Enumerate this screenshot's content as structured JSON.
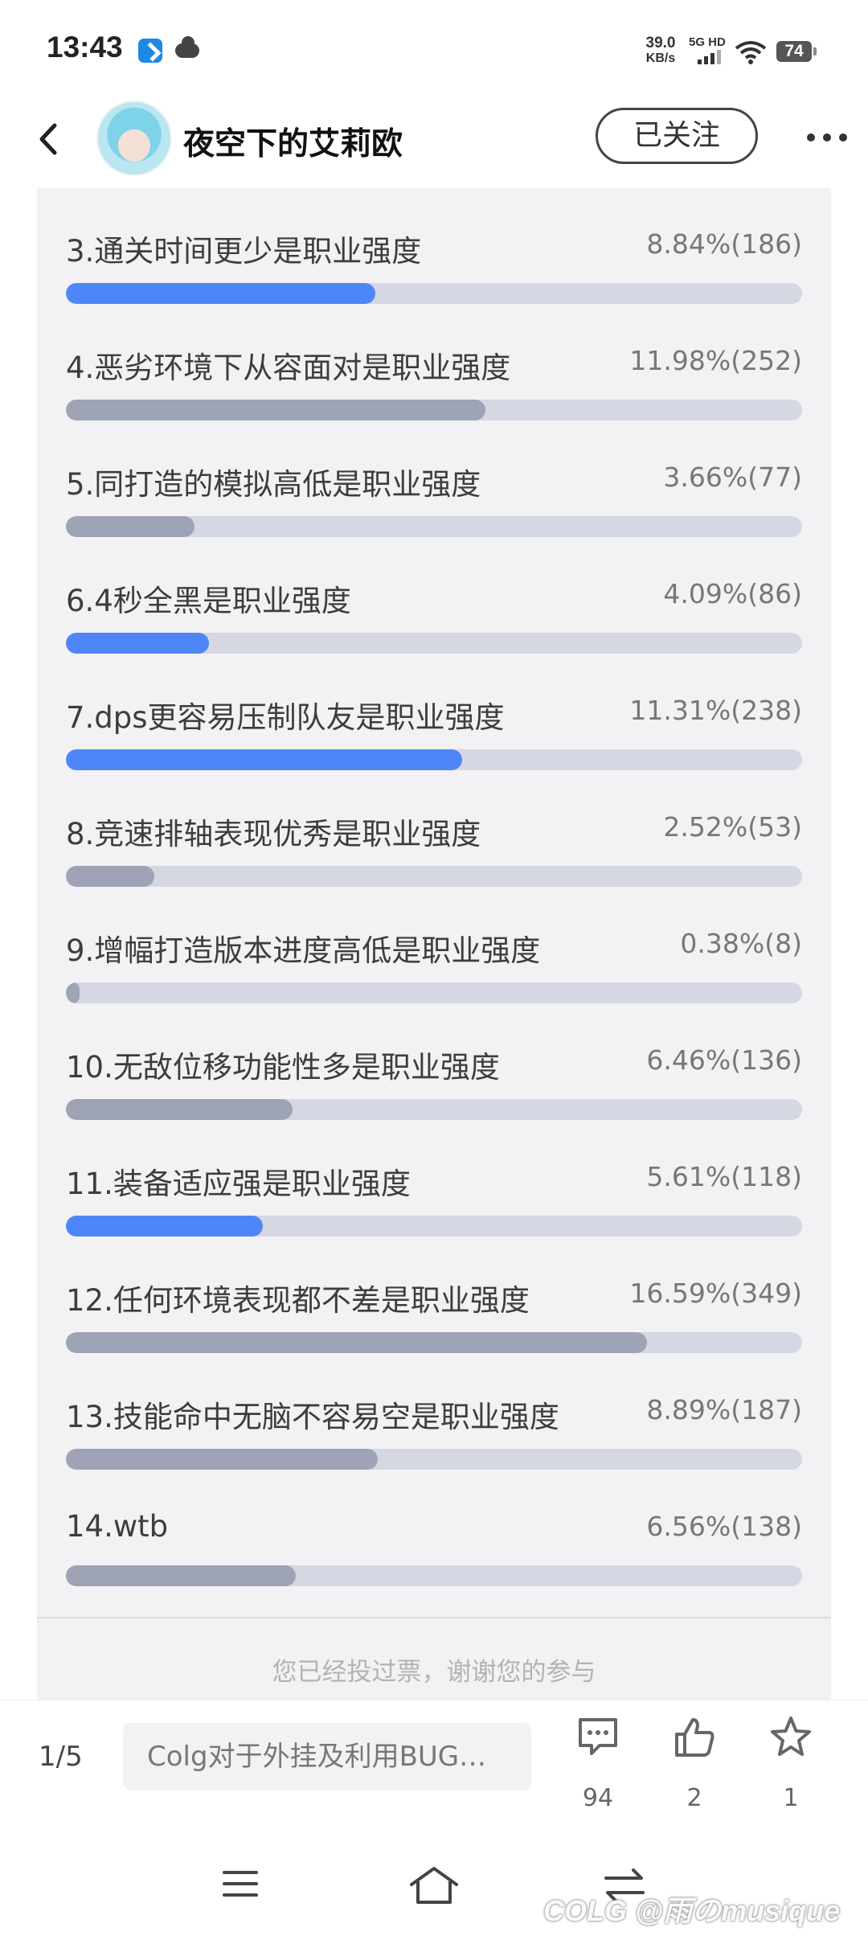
{
  "status_bar": {
    "time": "13:43",
    "net_speed_value": "39.0",
    "net_speed_unit": "KB/s",
    "network": "5G HD",
    "battery": "74"
  },
  "header": {
    "username": "夜空下的艾莉欧",
    "follow_label": "已关注"
  },
  "poll": {
    "options": [
      {
        "label": "3.通关时间更少是职业强度",
        "percent_text": "8.84%(186)",
        "percent": 8.84,
        "color": "#4f86f7"
      },
      {
        "label": "4.恶劣环境下从容面对是职业强度",
        "percent_text": "11.98%(252)",
        "percent": 11.98,
        "color": "#9fa3b6"
      },
      {
        "label": "5.同打造的模拟高低是职业强度",
        "percent_text": "3.66%(77)",
        "percent": 3.66,
        "color": "#9fa3b6"
      },
      {
        "label": "6.4秒全黑是职业强度",
        "percent_text": "4.09%(86)",
        "percent": 4.09,
        "color": "#4f86f7"
      },
      {
        "label": "7.dps更容易压制队友是职业强度",
        "percent_text": "11.31%(238)",
        "percent": 11.31,
        "color": "#4f86f7"
      },
      {
        "label": "8.竞速排轴表现优秀是职业强度",
        "percent_text": "2.52%(53)",
        "percent": 2.52,
        "color": "#9fa3b6"
      },
      {
        "label": "9.增幅打造版本进度高低是职业强度",
        "percent_text": "0.38%(8)",
        "percent": 0.38,
        "color": "#9fa3b6"
      },
      {
        "label": "10.无敌位移功能性多是职业强度",
        "percent_text": "6.46%(136)",
        "percent": 6.46,
        "color": "#9fa3b6"
      },
      {
        "label": "11.装备适应强是职业强度",
        "percent_text": "5.61%(118)",
        "percent": 5.61,
        "color": "#4f86f7"
      },
      {
        "label": "12.任何环境表现都不差是职业强度",
        "percent_text": "16.59%(349)",
        "percent": 16.59,
        "color": "#9fa3b6"
      },
      {
        "label": "13.技能命中无脑不容易空是职业强度",
        "percent_text": "8.89%(187)",
        "percent": 8.89,
        "color": "#9fa3b6"
      },
      {
        "label": "14.wtb",
        "percent_text": "6.56%(138)",
        "percent": 6.56,
        "color": "#9fa3b6"
      }
    ],
    "voted_note": "您已经投过票，谢谢您的参与"
  },
  "action_bar": {
    "page_indicator": "1/5",
    "post_title": "Colg对于外挂及利用BUG…",
    "comment_count": "94",
    "like_count": "2",
    "favorite_count": "1"
  },
  "watermark": "COLG @雨のmusique"
}
